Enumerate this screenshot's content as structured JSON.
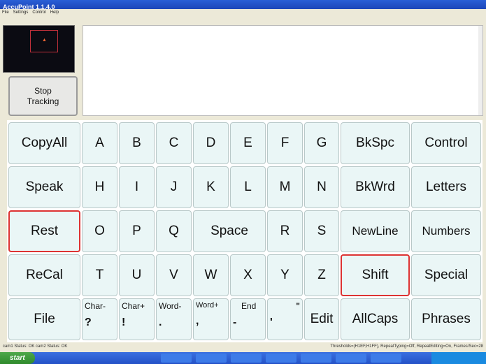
{
  "window": {
    "title": "AccuPoint 1.1.4.0"
  },
  "menu": [
    "File",
    "Settings",
    "Control",
    "Help"
  ],
  "stop_button": {
    "line1": "Stop",
    "line2": "Tracking"
  },
  "keys": {
    "row1": [
      "CopyAll",
      "A",
      "B",
      "C",
      "D",
      "E",
      "F",
      "G",
      "BkSpc",
      "Control"
    ],
    "row2": [
      "Speak",
      "H",
      "I",
      "J",
      "K",
      "L",
      "M",
      "N",
      "BkWrd",
      "Letters"
    ],
    "row3": [
      "Rest",
      "O",
      "P",
      "Q",
      "Space",
      "R",
      "S",
      "NewLine",
      "Numbers"
    ],
    "row4": [
      "ReCal",
      "T",
      "U",
      "V",
      "W",
      "X",
      "Y",
      "Z",
      "Shift",
      "Special"
    ],
    "row5": {
      "file": "File",
      "char_minus": {
        "label": "Char-",
        "glyph": "?"
      },
      "char_plus": {
        "label": "Char+",
        "glyph": "!"
      },
      "word_minus": {
        "label": "Word-",
        "glyph": "."
      },
      "word_plus": {
        "label": "Word+",
        "glyph": ","
      },
      "end": {
        "label": "End",
        "glyph": "-"
      },
      "quote": {
        "label": "\"",
        "glyph": "'"
      },
      "edit": "Edit",
      "allcaps": "AllCaps",
      "phrases": "Phrases"
    }
  },
  "status": {
    "left": "cam1 Status: OK cam2 Status: OK",
    "right": "Thresholds=(H1EF,H1FF), RepeatTyping=Off, RepeatEditing=On, Frames/Sec=28"
  },
  "taskbar": {
    "start": "start"
  },
  "accent_colors": {
    "selected_border": "#d33333",
    "key_bg": "#eaf6f6"
  }
}
